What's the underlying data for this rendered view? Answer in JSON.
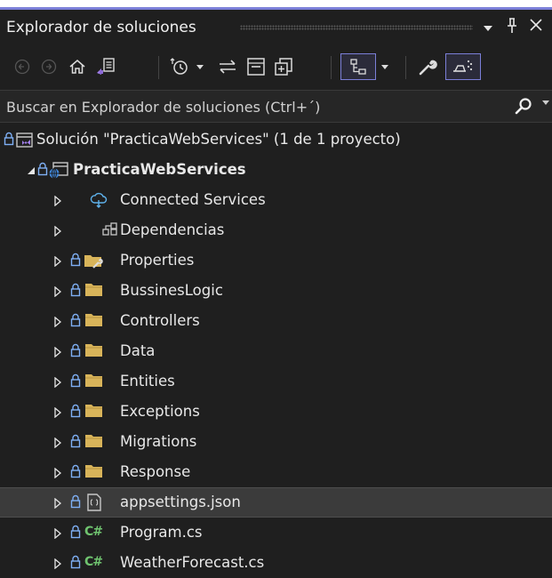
{
  "panel": {
    "title": "Explorador de soluciones",
    "accent_color": "#7b7fd8"
  },
  "toolbar": {
    "icons": [
      "back-icon",
      "forward-icon",
      "home-icon",
      "switch-views-icon",
      "pending-changes-icon",
      "sync-icon",
      "collapse-all-icon",
      "show-all-files-icon",
      "preview-selected-icon",
      "properties-icon",
      "file-nesting-icon"
    ]
  },
  "search": {
    "placeholder": "Buscar en Explorador de soluciones (Ctrl+´)"
  },
  "tree": {
    "solution": "Solución \"PracticaWebServices\"  (1 de 1 proyecto)",
    "project": "PracticaWebServices",
    "items": [
      {
        "label": "Connected Services",
        "icon": "connected-services-icon"
      },
      {
        "label": "Dependencias",
        "icon": "dependencies-icon"
      },
      {
        "label": "Properties",
        "icon": "properties-folder-icon"
      },
      {
        "label": "BussinesLogic",
        "icon": "folder-icon"
      },
      {
        "label": "Controllers",
        "icon": "folder-icon"
      },
      {
        "label": "Data",
        "icon": "folder-icon"
      },
      {
        "label": "Entities",
        "icon": "folder-icon"
      },
      {
        "label": "Exceptions",
        "icon": "folder-icon"
      },
      {
        "label": "Migrations",
        "icon": "folder-icon"
      },
      {
        "label": "Response",
        "icon": "folder-icon"
      },
      {
        "label": "appsettings.json",
        "icon": "json-file-icon"
      },
      {
        "label": "Program.cs",
        "icon": "csharp-file-icon",
        "prefix": "C#"
      },
      {
        "label": "WeatherForecast.cs",
        "icon": "csharp-file-icon",
        "prefix": "C#"
      }
    ]
  }
}
